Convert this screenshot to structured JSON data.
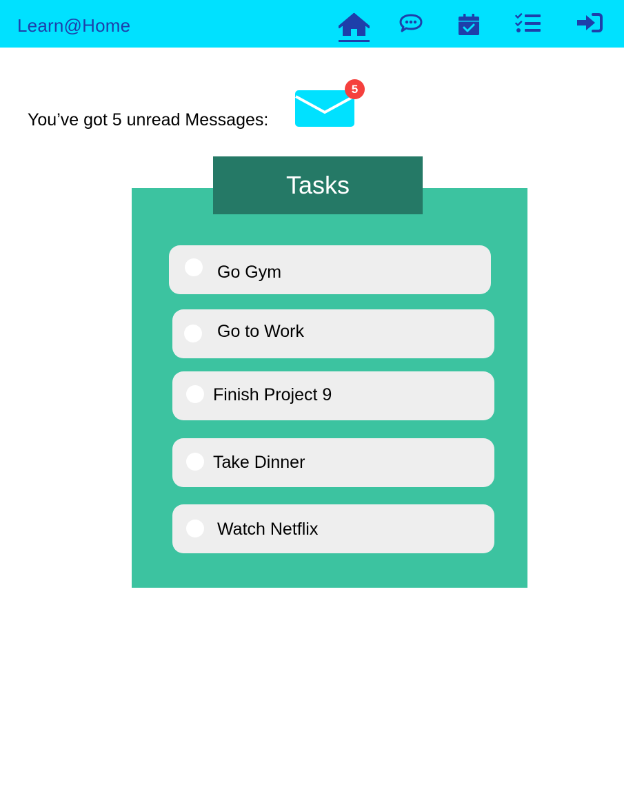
{
  "app": {
    "title": "Learn@Home"
  },
  "nav": {
    "items": [
      {
        "name": "home",
        "icon": "home-icon",
        "active": true
      },
      {
        "name": "chat",
        "icon": "chat-bubble-icon",
        "active": false
      },
      {
        "name": "calendar",
        "icon": "calendar-check-icon",
        "active": false
      },
      {
        "name": "tasks",
        "icon": "checklist-icon",
        "active": false
      },
      {
        "name": "sign-in",
        "icon": "sign-in-icon",
        "active": false
      }
    ]
  },
  "messages": {
    "text": "You’ve got 5 unread Messages:",
    "unread_count": "5",
    "icon": "envelope-icon"
  },
  "tasks": {
    "header": "Tasks",
    "items": [
      {
        "label": "Go Gym",
        "done": false
      },
      {
        "label": "Go to Work",
        "done": false
      },
      {
        "label": "Finish Project 9",
        "done": false
      },
      {
        "label": "Take Dinner",
        "done": false
      },
      {
        "label": "Watch Netflix",
        "done": false
      }
    ]
  },
  "colors": {
    "topbar": "#00E1FF",
    "icon": "#1E3FAA",
    "panel": "#3CC3A0",
    "panel_header": "#257966",
    "task_bg": "#EEEEEE",
    "badge": "#F5403D",
    "envelope": "#00E1FF"
  }
}
